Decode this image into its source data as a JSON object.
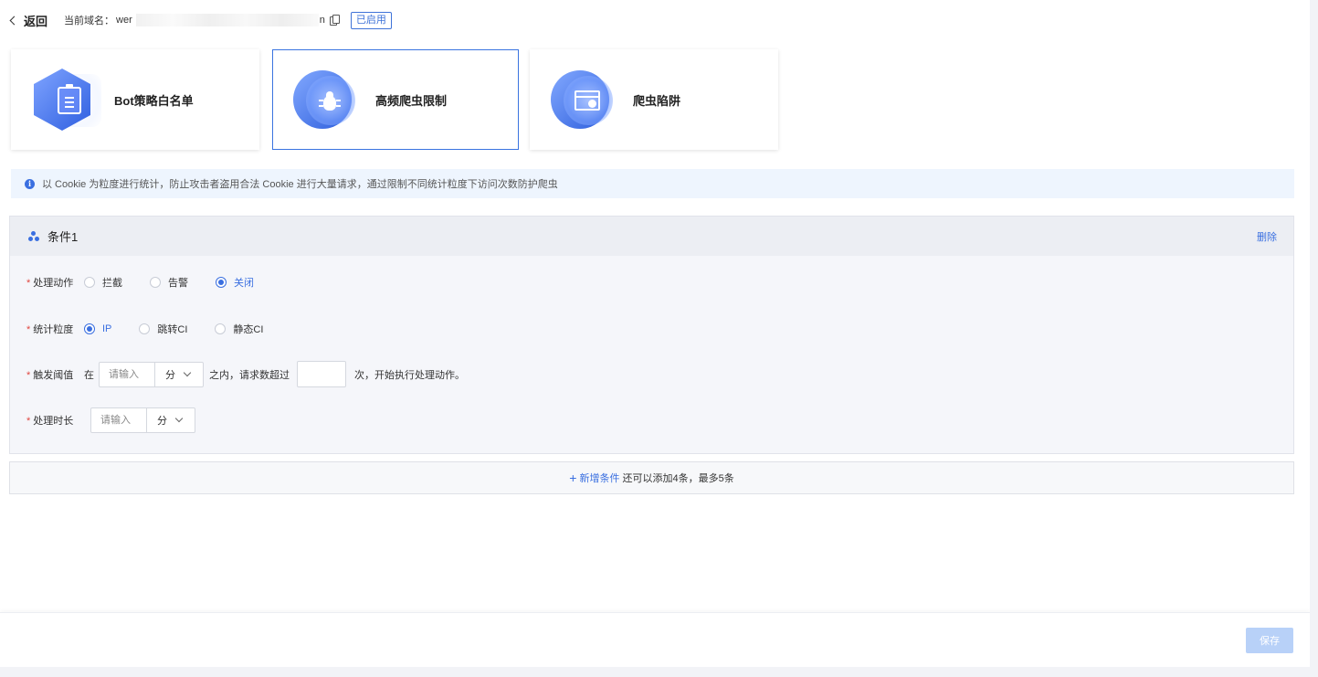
{
  "header": {
    "back_label": "返回",
    "domain_label": "当前域名：",
    "domain_value_start": "wer",
    "domain_value_end": "n",
    "status_badge": "已启用"
  },
  "cards": [
    {
      "title": "Bot策略白名单",
      "icon": "whitelist-doc-icon",
      "active": false
    },
    {
      "title": "高频爬虫限制",
      "icon": "bug-icon",
      "active": true
    },
    {
      "title": "爬虫陷阱",
      "icon": "crawler-trap-icon",
      "active": false
    }
  ],
  "notice": {
    "text": "以 Cookie 为粒度进行统计，防止攻击者盗用合法 Cookie 进行大量请求，通过限制不同统计粒度下访问次数防护爬虫"
  },
  "condition": {
    "title": "条件1",
    "delete_label": "删除",
    "action": {
      "label": "处理动作",
      "options": [
        "拦截",
        "告警",
        "关闭"
      ],
      "selected": "关闭"
    },
    "granularity": {
      "label": "统计粒度",
      "options": [
        "IP",
        "跳转CI",
        "静态CI"
      ],
      "selected": "IP"
    },
    "threshold": {
      "label": "触发阈值",
      "prefix": "在",
      "placeholder": "请输入",
      "unit": "分",
      "middle": "之内，请求数超过",
      "suffix": "次，开始执行处理动作。"
    },
    "duration": {
      "label": "处理时长",
      "placeholder": "请输入",
      "unit": "分"
    }
  },
  "add_condition": {
    "link": "新增条件",
    "hint": "还可以添加4条，最多5条"
  },
  "footer": {
    "save_label": "保存"
  },
  "colors": {
    "accent": "#3a6fe0",
    "notice_bg": "#eef5fe",
    "save_disabled": "#b8d1f8",
    "required": "#e0463f"
  }
}
